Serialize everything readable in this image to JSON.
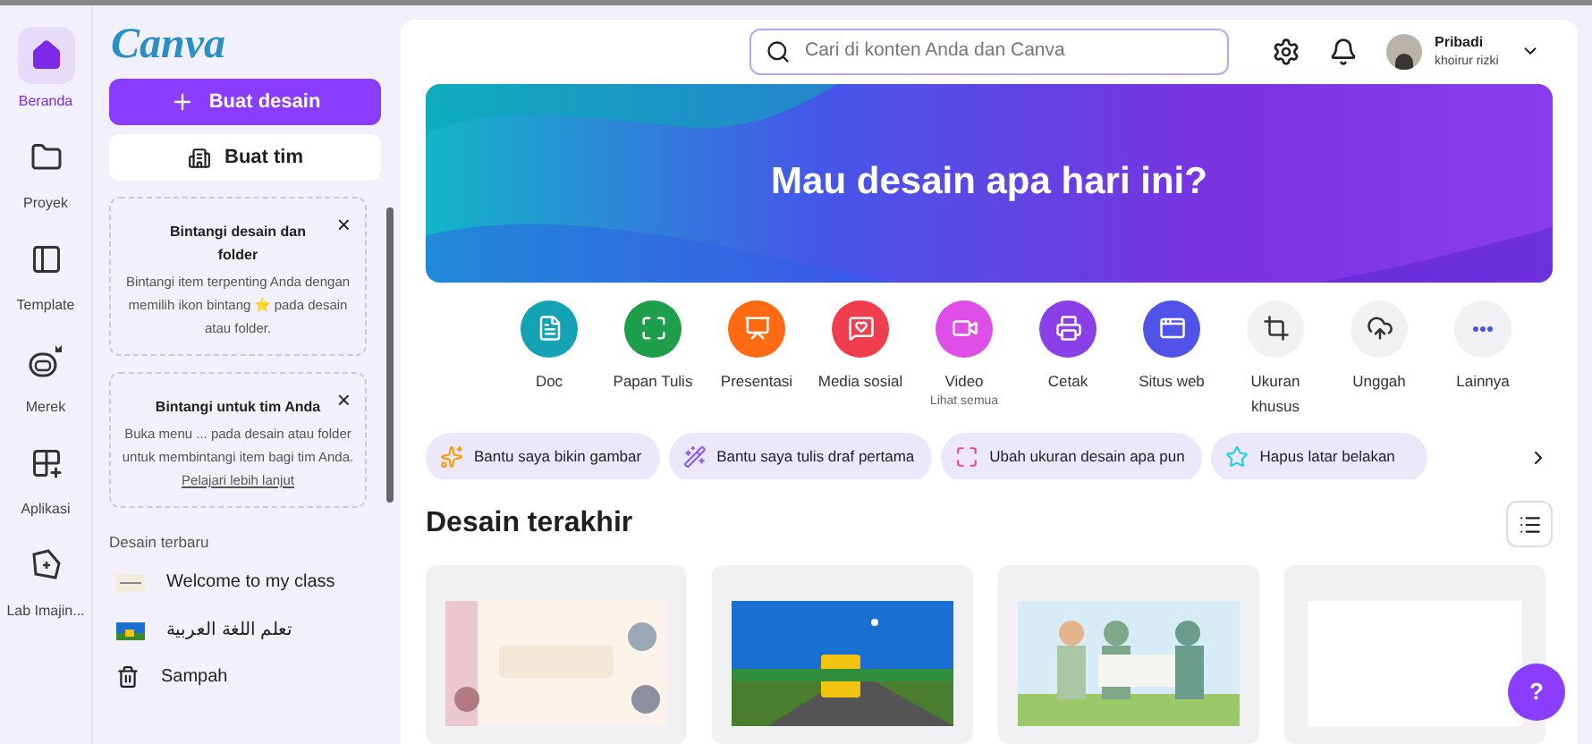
{
  "rail": [
    {
      "label": "Beranda",
      "selected": true
    },
    {
      "label": "Proyek",
      "selected": false
    },
    {
      "label": "Template",
      "selected": false
    },
    {
      "label": "Merek",
      "selected": false
    },
    {
      "label": "Aplikasi",
      "selected": false
    },
    {
      "label": "Lab Imajin...",
      "selected": false
    }
  ],
  "sidebar": {
    "logo": "Canva",
    "create_button": "Buat desain",
    "team_button": "Buat tim",
    "cards": [
      {
        "title": "Bintangi desain dan folder",
        "body": "Bintangi item terpenting Anda dengan memilih ikon bintang ⭐ pada desain atau folder.",
        "close": "×"
      },
      {
        "title": "Bintangi untuk tim Anda",
        "body": "Buka menu ... pada desain atau folder untuk membintangi item bagi tim Anda.",
        "link": "Pelajari lebih lanjut",
        "close": "×"
      }
    ],
    "recent_heading": "Desain terbaru",
    "recent": [
      {
        "label": "Welcome to my class"
      },
      {
        "label": "تعلم اللغة العربية"
      }
    ],
    "trash": "Sampah"
  },
  "search": {
    "placeholder": "Cari di konten Anda dan Canva"
  },
  "account": {
    "name": "Pribadi",
    "user": "khoirur rizki"
  },
  "banner": {
    "title": "Mau desain apa hari ini?"
  },
  "types": [
    {
      "label": "Doc",
      "color": "#13a3b4"
    },
    {
      "label": "Papan Tulis",
      "color": "#1e9e4a"
    },
    {
      "label": "Presentasi",
      "color": "#ff6a13"
    },
    {
      "label": "Media sosial",
      "color": "#f03e4f"
    },
    {
      "label": "Video",
      "sub": "Lihat semua",
      "color": "#e04ee8"
    },
    {
      "label": "Cetak",
      "color": "#8b3fe6"
    },
    {
      "label": "Situs web",
      "color": "#4f53e8"
    },
    {
      "label": "Ukuran khusus",
      "color": "#f1f1f3"
    },
    {
      "label": "Unggah",
      "color": "#f1f1f3"
    },
    {
      "label": "Lainnya",
      "color": "#f1f1f3"
    }
  ],
  "chips": [
    {
      "label": "Bantu saya bikin gambar"
    },
    {
      "label": "Bantu saya tulis draf pertama"
    },
    {
      "label": "Ubah ukuran desain apa pun"
    },
    {
      "label": "Hapus latar belakan"
    }
  ],
  "recent_section": {
    "title": "Desain terakhir",
    "designs": [
      {
        "kind": "picture"
      },
      {
        "kind": "picture"
      },
      {
        "kind": "picture"
      },
      {
        "kind": "blank"
      }
    ]
  },
  "help": "?"
}
